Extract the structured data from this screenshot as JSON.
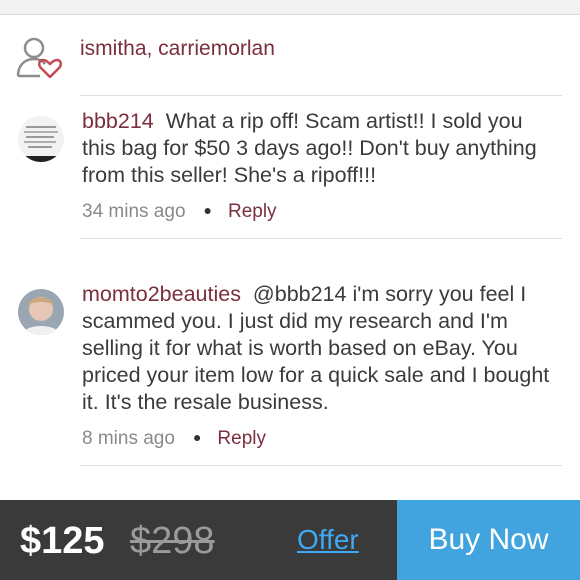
{
  "likes": {
    "icon": "user-heart-icon",
    "names": "ismitha, carriemorlan"
  },
  "comments": [
    {
      "username": "bbb214",
      "text": "What a rip off!  Scam artist!!  I sold you this bag for $50 3 days ago!!  Don't buy anything from this seller!  She's a ripoff!!!",
      "time": "34 mins ago",
      "reply_label": "Reply"
    },
    {
      "username": "momto2beauties",
      "text": "@bbb214 i'm sorry you feel I scammed you. I just did my research and I'm selling it for what is worth based on eBay. You priced your item low for a quick sale and I bought it. It's the resale business.",
      "time": "8 mins ago",
      "reply_label": "Reply"
    }
  ],
  "footer": {
    "price": "$125",
    "original_price": "$298",
    "offer_label": "Offer",
    "buy_label": "Buy Now"
  },
  "colors": {
    "accent": "#7a2f3e",
    "link_blue": "#3fa9f5",
    "buy_button": "#41a4de",
    "footer_bg": "#3a3a3a"
  }
}
